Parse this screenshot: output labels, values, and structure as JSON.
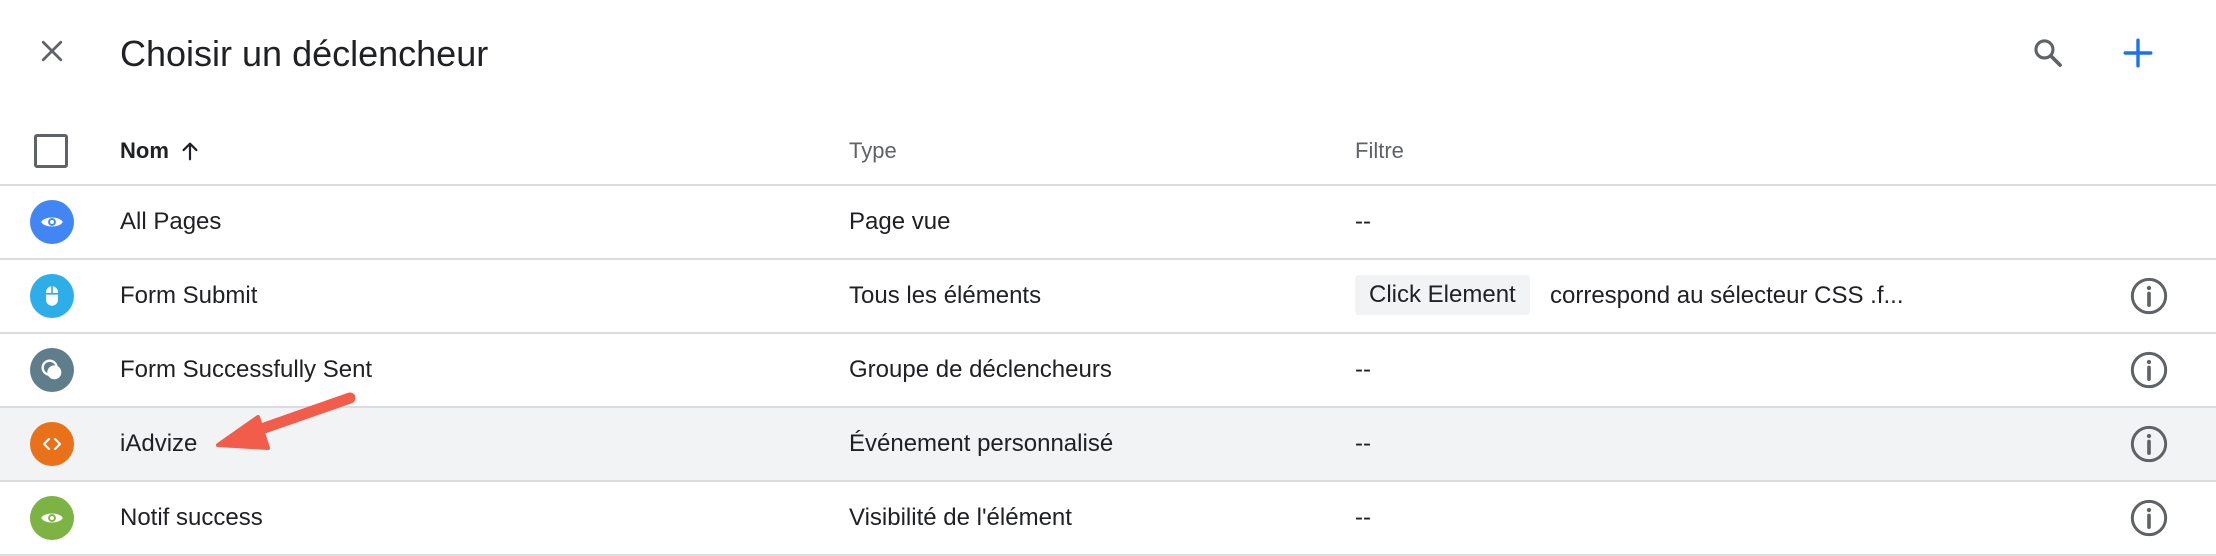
{
  "header": {
    "title": "Choisir un déclencheur",
    "close_icon": "close-icon",
    "search_icon": "search-icon",
    "add_icon": "plus-icon"
  },
  "table": {
    "columns": {
      "name": "Nom",
      "type": "Type",
      "filter": "Filtre"
    },
    "sort_icon": "arrow-up-icon",
    "rows": [
      {
        "name": "All Pages",
        "type": "Page vue",
        "filter": "--",
        "icon": "eye-icon",
        "color": "#4285f4",
        "info": false
      },
      {
        "name": "Form Submit",
        "type": "Tous les éléments",
        "filter_chip": "Click Element",
        "filter": "correspond au sélecteur CSS .f...",
        "icon": "mouse-icon",
        "color": "#2eaee8",
        "info": true
      },
      {
        "name": "Form Successfully Sent",
        "type": "Groupe de déclencheurs",
        "filter": "--",
        "icon": "trigger-group-icon",
        "color": "#607d8b",
        "info": true
      },
      {
        "name": "iAdvize",
        "type": "Événement personnalisé",
        "filter": "--",
        "icon": "code-icon",
        "color": "#e8711a",
        "info": true,
        "highlighted": true
      },
      {
        "name": "Notif success",
        "type": "Visibilité de l'élément",
        "filter": "--",
        "icon": "eye-icon",
        "color": "#7cb342",
        "info": true
      }
    ]
  },
  "annotation": {
    "arrow_color": "#f25c4a",
    "points_to": "iAdvize"
  },
  "colors": {
    "accent": "#1a73e8",
    "icon_gray": "#5f6368",
    "divider": "#dadce0",
    "highlight_row": "#f1f3f4"
  }
}
